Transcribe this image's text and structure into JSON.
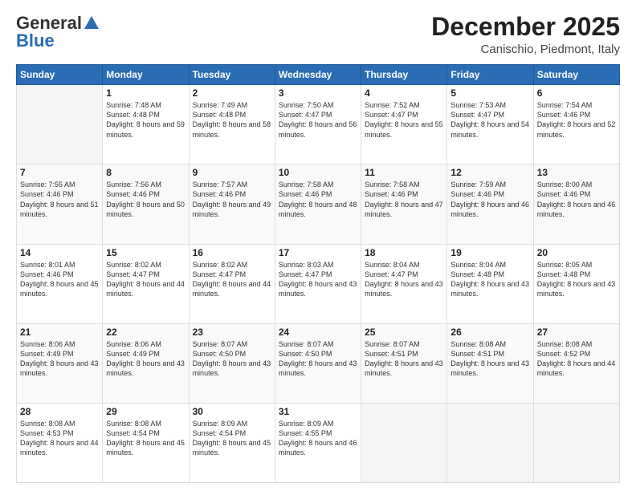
{
  "header": {
    "logo_general": "General",
    "logo_blue": "Blue",
    "month_title": "December 2025",
    "location": "Canischio, Piedmont, Italy"
  },
  "weekdays": [
    "Sunday",
    "Monday",
    "Tuesday",
    "Wednesday",
    "Thursday",
    "Friday",
    "Saturday"
  ],
  "weeks": [
    [
      {
        "day": "",
        "sunrise": "",
        "sunset": "",
        "daylight": ""
      },
      {
        "day": "1",
        "sunrise": "Sunrise: 7:48 AM",
        "sunset": "Sunset: 4:48 PM",
        "daylight": "Daylight: 8 hours and 59 minutes."
      },
      {
        "day": "2",
        "sunrise": "Sunrise: 7:49 AM",
        "sunset": "Sunset: 4:48 PM",
        "daylight": "Daylight: 8 hours and 58 minutes."
      },
      {
        "day": "3",
        "sunrise": "Sunrise: 7:50 AM",
        "sunset": "Sunset: 4:47 PM",
        "daylight": "Daylight: 8 hours and 56 minutes."
      },
      {
        "day": "4",
        "sunrise": "Sunrise: 7:52 AM",
        "sunset": "Sunset: 4:47 PM",
        "daylight": "Daylight: 8 hours and 55 minutes."
      },
      {
        "day": "5",
        "sunrise": "Sunrise: 7:53 AM",
        "sunset": "Sunset: 4:47 PM",
        "daylight": "Daylight: 8 hours and 54 minutes."
      },
      {
        "day": "6",
        "sunrise": "Sunrise: 7:54 AM",
        "sunset": "Sunset: 4:46 PM",
        "daylight": "Daylight: 8 hours and 52 minutes."
      }
    ],
    [
      {
        "day": "7",
        "sunrise": "Sunrise: 7:55 AM",
        "sunset": "Sunset: 4:46 PM",
        "daylight": "Daylight: 8 hours and 51 minutes."
      },
      {
        "day": "8",
        "sunrise": "Sunrise: 7:56 AM",
        "sunset": "Sunset: 4:46 PM",
        "daylight": "Daylight: 8 hours and 50 minutes."
      },
      {
        "day": "9",
        "sunrise": "Sunrise: 7:57 AM",
        "sunset": "Sunset: 4:46 PM",
        "daylight": "Daylight: 8 hours and 49 minutes."
      },
      {
        "day": "10",
        "sunrise": "Sunrise: 7:58 AM",
        "sunset": "Sunset: 4:46 PM",
        "daylight": "Daylight: 8 hours and 48 minutes."
      },
      {
        "day": "11",
        "sunrise": "Sunrise: 7:58 AM",
        "sunset": "Sunset: 4:46 PM",
        "daylight": "Daylight: 8 hours and 47 minutes."
      },
      {
        "day": "12",
        "sunrise": "Sunrise: 7:59 AM",
        "sunset": "Sunset: 4:46 PM",
        "daylight": "Daylight: 8 hours and 46 minutes."
      },
      {
        "day": "13",
        "sunrise": "Sunrise: 8:00 AM",
        "sunset": "Sunset: 4:46 PM",
        "daylight": "Daylight: 8 hours and 46 minutes."
      }
    ],
    [
      {
        "day": "14",
        "sunrise": "Sunrise: 8:01 AM",
        "sunset": "Sunset: 4:46 PM",
        "daylight": "Daylight: 8 hours and 45 minutes."
      },
      {
        "day": "15",
        "sunrise": "Sunrise: 8:02 AM",
        "sunset": "Sunset: 4:47 PM",
        "daylight": "Daylight: 8 hours and 44 minutes."
      },
      {
        "day": "16",
        "sunrise": "Sunrise: 8:02 AM",
        "sunset": "Sunset: 4:47 PM",
        "daylight": "Daylight: 8 hours and 44 minutes."
      },
      {
        "day": "17",
        "sunrise": "Sunrise: 8:03 AM",
        "sunset": "Sunset: 4:47 PM",
        "daylight": "Daylight: 8 hours and 43 minutes."
      },
      {
        "day": "18",
        "sunrise": "Sunrise: 8:04 AM",
        "sunset": "Sunset: 4:47 PM",
        "daylight": "Daylight: 8 hours and 43 minutes."
      },
      {
        "day": "19",
        "sunrise": "Sunrise: 8:04 AM",
        "sunset": "Sunset: 4:48 PM",
        "daylight": "Daylight: 8 hours and 43 minutes."
      },
      {
        "day": "20",
        "sunrise": "Sunrise: 8:05 AM",
        "sunset": "Sunset: 4:48 PM",
        "daylight": "Daylight: 8 hours and 43 minutes."
      }
    ],
    [
      {
        "day": "21",
        "sunrise": "Sunrise: 8:06 AM",
        "sunset": "Sunset: 4:49 PM",
        "daylight": "Daylight: 8 hours and 43 minutes."
      },
      {
        "day": "22",
        "sunrise": "Sunrise: 8:06 AM",
        "sunset": "Sunset: 4:49 PM",
        "daylight": "Daylight: 8 hours and 43 minutes."
      },
      {
        "day": "23",
        "sunrise": "Sunrise: 8:07 AM",
        "sunset": "Sunset: 4:50 PM",
        "daylight": "Daylight: 8 hours and 43 minutes."
      },
      {
        "day": "24",
        "sunrise": "Sunrise: 8:07 AM",
        "sunset": "Sunset: 4:50 PM",
        "daylight": "Daylight: 8 hours and 43 minutes."
      },
      {
        "day": "25",
        "sunrise": "Sunrise: 8:07 AM",
        "sunset": "Sunset: 4:51 PM",
        "daylight": "Daylight: 8 hours and 43 minutes."
      },
      {
        "day": "26",
        "sunrise": "Sunrise: 8:08 AM",
        "sunset": "Sunset: 4:51 PM",
        "daylight": "Daylight: 8 hours and 43 minutes."
      },
      {
        "day": "27",
        "sunrise": "Sunrise: 8:08 AM",
        "sunset": "Sunset: 4:52 PM",
        "daylight": "Daylight: 8 hours and 44 minutes."
      }
    ],
    [
      {
        "day": "28",
        "sunrise": "Sunrise: 8:08 AM",
        "sunset": "Sunset: 4:53 PM",
        "daylight": "Daylight: 8 hours and 44 minutes."
      },
      {
        "day": "29",
        "sunrise": "Sunrise: 8:08 AM",
        "sunset": "Sunset: 4:54 PM",
        "daylight": "Daylight: 8 hours and 45 minutes."
      },
      {
        "day": "30",
        "sunrise": "Sunrise: 8:09 AM",
        "sunset": "Sunset: 4:54 PM",
        "daylight": "Daylight: 8 hours and 45 minutes."
      },
      {
        "day": "31",
        "sunrise": "Sunrise: 8:09 AM",
        "sunset": "Sunset: 4:55 PM",
        "daylight": "Daylight: 8 hours and 46 minutes."
      },
      {
        "day": "",
        "sunrise": "",
        "sunset": "",
        "daylight": ""
      },
      {
        "day": "",
        "sunrise": "",
        "sunset": "",
        "daylight": ""
      },
      {
        "day": "",
        "sunrise": "",
        "sunset": "",
        "daylight": ""
      }
    ]
  ]
}
